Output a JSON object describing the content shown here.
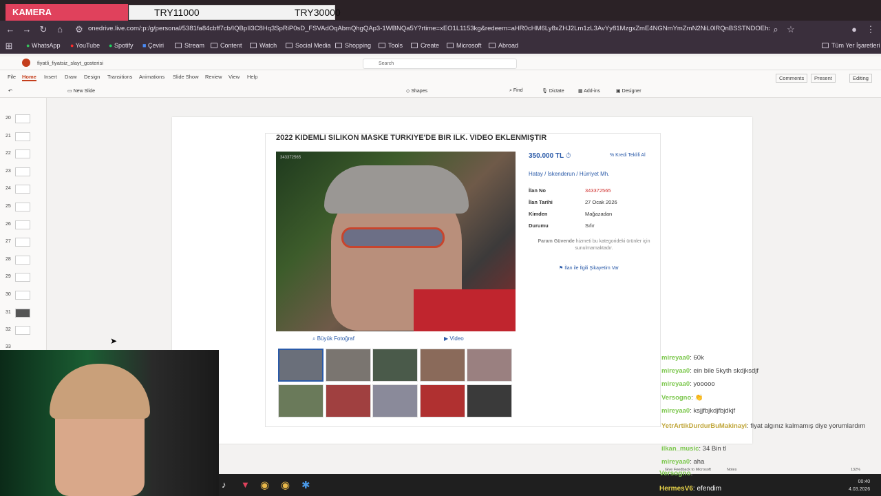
{
  "overlay": {
    "camera_label": "KAMERA",
    "amount1": "TRY11000",
    "amount2": "TRY30000"
  },
  "browser": {
    "url": "onedrive.live.com/:p:/g/personal/5381fa84cbff7cb/IQBpII3C8Hq3SpRiP0sD_FSVAdOqAbmQhgQAp3-1WBNQa5Y?rtime=xEO1L1153kg&redeem=aHR0cHM6Ly8xZHJ2Lm1zL3AvYy81MzgxZmE4NGNmYmZmN2NiL0lRQnBSSTNDOEhxM1Nw...",
    "bookmarks": [
      "WhatsApp",
      "YouTube",
      "Spotify",
      "Çeviri",
      "Stream",
      "Content",
      "Watch",
      "Social Media",
      "Shopping",
      "Tools",
      "Create",
      "Microsoft",
      "Abroad"
    ],
    "all_bookmarks": "Tüm Yer İşaretleri"
  },
  "office": {
    "doc_title": "fiyatli_fiyatsiz_slayt_gosterisi",
    "search_placeholder": "Search",
    "tabs": [
      "File",
      "Home",
      "Insert",
      "Draw",
      "Design",
      "Transitions",
      "Animations",
      "Slide Show",
      "Review",
      "View",
      "Help"
    ],
    "right_buttons": [
      "Comments",
      "Present",
      "Editing"
    ],
    "ribbon": {
      "new_slide": "New Slide",
      "shapes": "Shapes",
      "find": "Find",
      "dictate": "Dictate",
      "addins": "Add-ins",
      "designer": "Designer"
    },
    "slide_numbers": [
      "20",
      "21",
      "22",
      "23",
      "24",
      "25",
      "26",
      "27",
      "28",
      "29",
      "30",
      "31",
      "32",
      "33"
    ],
    "status": "Give Feedback to Microsoft",
    "notes": "Notes",
    "zoom": "132%"
  },
  "listing": {
    "title": "2022 KIDEMLI SILIKON MASKE TURKIYE'DE BIR ILK. VIDEO EKLENMIŞTIR",
    "photo_id": "343372565",
    "big_photo": "Büyük Fotoğraf",
    "video": "Video",
    "price": "350.000 TL",
    "credit": "Kredi Teklifi Al",
    "location": [
      "Hatay",
      "İskenderun",
      "Hürriyet Mh."
    ],
    "details": [
      {
        "k": "İlan No",
        "v": "343372565"
      },
      {
        "k": "İlan Tarihi",
        "v": "27 Ocak 2026"
      },
      {
        "k": "Kimden",
        "v": "Mağazadan"
      },
      {
        "k": "Durumu",
        "v": "Sıfır"
      }
    ],
    "safe_notice_label": "Param Güvende",
    "safe_notice_rest": "hizmeti bu kategorideki ürünler için sunulmamaktadır.",
    "complaint": "İlan ile İlgili Şikayetim Var"
  },
  "chat": [
    {
      "user": "mireyaa0",
      "text": ": 60k"
    },
    {
      "user": "mireyaa0",
      "text": ": ein bile 5kyth skdjksdjf"
    },
    {
      "user": "mireyaa0",
      "text": ": yooooo"
    },
    {
      "user": "Versogno",
      "text": ": 👏"
    },
    {
      "user": "mireyaa0",
      "text": ": ksjjfbjkdjfbjdkjf"
    },
    {
      "user": "YetrArtikDurdurBuMakinayi",
      "text": ": fiyat algınız kalmamış diye yorumlardım"
    },
    {
      "user": "ilkan_music",
      "text": ": 34 Bin tl"
    },
    {
      "user": "mireyaa0",
      "text": ": aha"
    },
    {
      "user": "Versogno",
      "text": ":"
    },
    {
      "user": "HermesV6",
      "text": ": efendim"
    }
  ],
  "taskbar": {
    "time": "00:40",
    "date": "4.03.2026"
  }
}
